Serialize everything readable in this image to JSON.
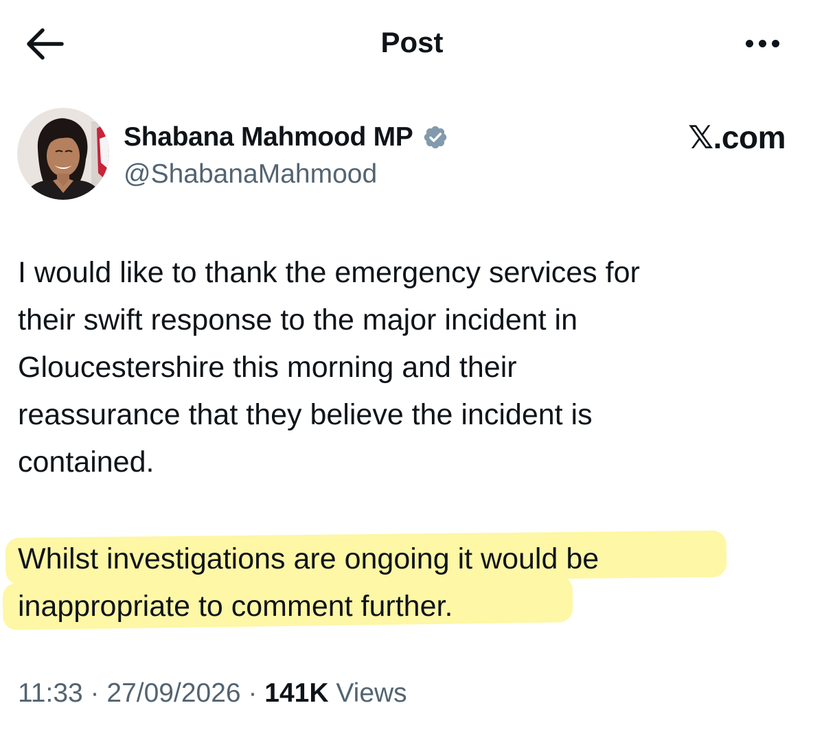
{
  "header": {
    "title": "Post",
    "back_icon": "arrow-left-icon",
    "more_icon": "more-horizontal-icon"
  },
  "author": {
    "display_name": "Shabana Mahmood MP",
    "handle": "@ShabanaMahmood",
    "verified_icon": "verified-badge-icon",
    "verified_color": "#829aab"
  },
  "source_watermark": "𝕏.com",
  "tweet": {
    "paragraph_1": "I would like to thank the emergency services for\ntheir swift response to the major incident in\nGloucestershire this morning and their\nreassurance that they believe the incident is\ncontained.",
    "paragraph_2": "Whilst investigations are ongoing it would be\ninappropriate to comment further.",
    "highlight_color": "#fdf7a6"
  },
  "meta": {
    "time": "11:33",
    "separator": "·",
    "date": "27/09/2026",
    "views_count": "141K",
    "views_label": "Views"
  }
}
